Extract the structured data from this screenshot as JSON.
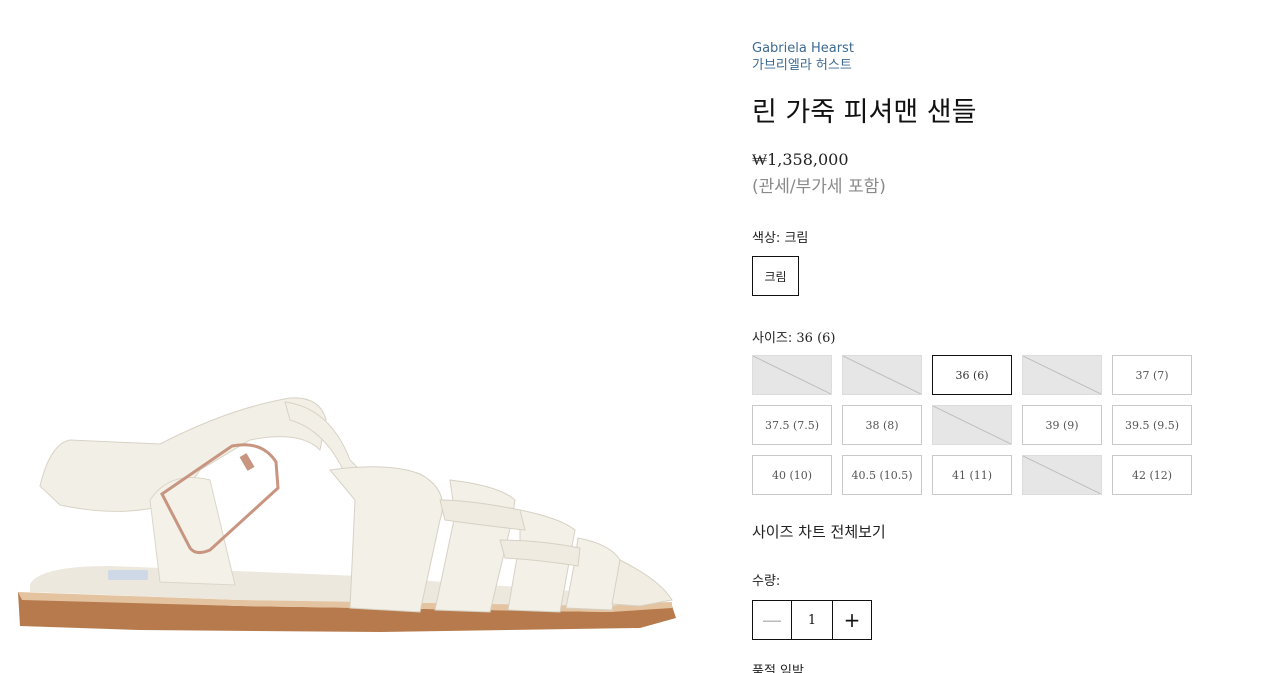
{
  "product": {
    "brand_en": "Gabriela Hearst",
    "brand_ko": "가브리엘라 허스트",
    "title": "린 가죽 피셔맨 샌들",
    "price": "₩1,358,000",
    "tax_note": "(관세/부가세 포함)"
  },
  "color": {
    "label": "색상:",
    "selected": "크림",
    "options": [
      "크림"
    ]
  },
  "size": {
    "label": "사이즈:",
    "selected": "36 (6)",
    "options": [
      {
        "label": "",
        "available": false
      },
      {
        "label": "",
        "available": false
      },
      {
        "label": "36 (6)",
        "available": true,
        "selected": true
      },
      {
        "label": "",
        "available": false
      },
      {
        "label": "37 (7)",
        "available": true
      },
      {
        "label": "37.5 (7.5)",
        "available": true
      },
      {
        "label": "38 (8)",
        "available": true
      },
      {
        "label": "",
        "available": false
      },
      {
        "label": "39 (9)",
        "available": true
      },
      {
        "label": "39.5 (9.5)",
        "available": true
      },
      {
        "label": "40 (10)",
        "available": true
      },
      {
        "label": "40.5 (10.5)",
        "available": true
      },
      {
        "label": "41 (11)",
        "available": true
      },
      {
        "label": "",
        "available": false
      },
      {
        "label": "42 (12)",
        "available": true
      }
    ],
    "chart_link": "사이즈 차트 전체보기"
  },
  "quantity": {
    "label": "수량:",
    "value": "1",
    "minus_icon": "minus-icon",
    "plus_icon": "plus-icon"
  },
  "stock": {
    "label": "품절 임박"
  },
  "colors": {
    "brand_link": "#3d6a93",
    "unavailable_bg": "#e6e6e6",
    "sandal_leather": "#f2efe6",
    "sole": "#b77a4c",
    "buckle": "#c79580"
  }
}
